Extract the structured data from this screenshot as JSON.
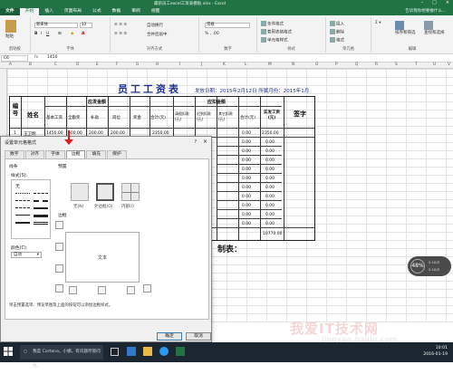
{
  "window": {
    "title": "最新员工excel工资表模板.xlsx - Excel"
  },
  "ribbon": {
    "tabs": [
      "文件",
      "开始",
      "插入",
      "页面布局",
      "公式",
      "数据",
      "审阅",
      "视图"
    ],
    "tell_me": "告诉我你想要做什么...",
    "font_name": "新宋体",
    "font_size": "12",
    "groups": [
      "剪贴板",
      "字体",
      "对齐方式",
      "数字",
      "样式",
      "单元格",
      "编辑"
    ],
    "buttons": {
      "paste": "粘贴",
      "wrap": "自动换行",
      "merge": "合并后居中",
      "number_format": "常规",
      "conditional": "条件格式",
      "table_format": "套用表格格式",
      "cell_style": "单元格样式",
      "insert": "插入",
      "delete": "删除",
      "format": "格式",
      "sort": "排序和筛选",
      "find": "查找和选择"
    }
  },
  "formula_bar": {
    "name_box": "C6",
    "fx": "fx",
    "value": "1450"
  },
  "columns": [
    "A",
    "B",
    "C",
    "D",
    "E",
    "F",
    "G",
    "H",
    "I",
    "J",
    "K",
    "L",
    "M",
    "N",
    "O",
    "P",
    "Q",
    "R",
    "S",
    "T",
    "U",
    "V"
  ],
  "sheet": {
    "title": "员工工资表",
    "meta": "发放日期：2015年2月12日  所属月份：2015年1月",
    "headers": {
      "id": "编号",
      "name": "姓名",
      "due": "应发金额",
      "deduct": "应扣金额",
      "net": "实发工资(元)",
      "sign": "签字",
      "due_sub": [
        "基本工资",
        "全勤奖",
        "补助",
        "岗位",
        "奖金",
        "合计(元)"
      ],
      "deduct_sub": [
        "请假扣款(元)",
        "迟到扣款(元)",
        "其它扣款(元)",
        "合计(元)"
      ]
    },
    "row1": {
      "id": "1",
      "name": "王卫明",
      "values": [
        "1450.00",
        "500.00",
        "200.00",
        "200.00",
        "",
        "2350.00"
      ],
      "deduct_total": "0.00",
      "net": "2350.00"
    },
    "deduct_totals": [
      "0.00",
      "0.00",
      "0.00",
      "0.00",
      "0.00",
      "0.00",
      "0.00",
      "0.00",
      "0.00",
      "0.00",
      "0.00",
      "0.00"
    ],
    "net_values": [
      "2350.00",
      "0.00",
      "0.00",
      "0.00",
      "0.00",
      "0.00",
      "0.00",
      "0.00",
      "0.00",
      "0.00",
      "0.00",
      "0.00",
      "0.00",
      "0.00"
    ],
    "grand_total": "10770.00",
    "signature_label": "制表："
  },
  "dialog": {
    "title": "设置单元格格式",
    "help": "?",
    "close": "×",
    "tabs": [
      "数字",
      "对齐",
      "字体",
      "边框",
      "填充",
      "保护"
    ],
    "active_tab": "边框",
    "line_label": "线条",
    "style_label": "样式(S):",
    "none_label": "无",
    "presets_label": "预置",
    "presets": [
      "无(N)",
      "外边框(O)",
      "内部(I)"
    ],
    "border_label": "边框",
    "preview_text": "文本",
    "color_label": "颜色(C):",
    "color_value": "自动",
    "hint": "单击预置选项、预览草图及上面的按钮可以添加边框样式。",
    "ok": "确定",
    "cancel": "取消"
  },
  "taskbar": {
    "search": "我是 Cortana，小娜。有问题尽管问我。",
    "time": "10:01",
    "date": "2016-01-19"
  },
  "floater": {
    "percent": "48%",
    "up": "0.1K/S",
    "down": "0.1K/S"
  },
  "watermark": {
    "text": "我爱IT技术网",
    "url": "jingyan.baidu.com"
  },
  "colors": {
    "excel_green": "#217346",
    "title_blue": "#1f2f8f",
    "arrow_red": "#e31a1a"
  }
}
